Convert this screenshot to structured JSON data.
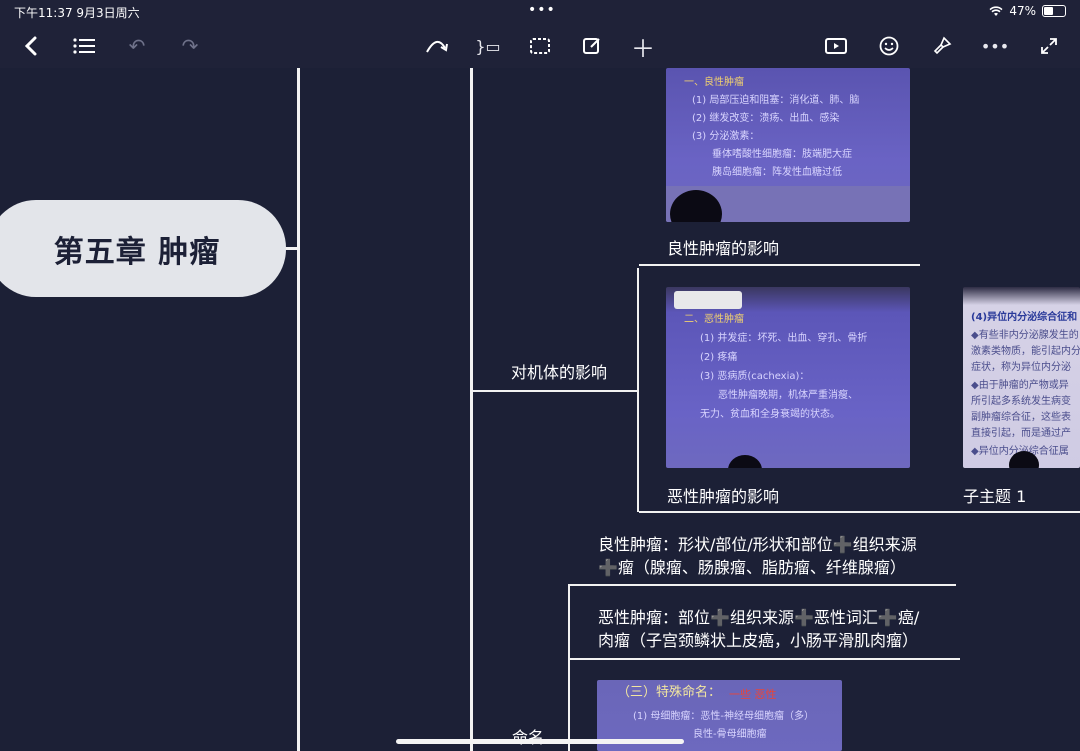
{
  "status": {
    "time": "下午11:37  9月3日周六",
    "dots": "•••",
    "battery": "47%"
  },
  "toolbar": {
    "back": "❮",
    "outline": "☰",
    "undo": "↶",
    "redo": "↷",
    "relationship": "⤼",
    "boundary": "}▭",
    "select": "⬚",
    "edit": "✎",
    "add": "＋",
    "present": "▶",
    "emoji": "☺",
    "brush": "🖌",
    "more": "•••",
    "expand": "⤢"
  },
  "mindmap": {
    "root": "第五章 肿瘤",
    "branch_effect": "对机体的影响",
    "benign_caption": "良性肿瘤的影响",
    "malignant_caption": "恶性肿瘤的影响",
    "subtopic_caption": "子主题 1",
    "naming_benign_line1": "良性肿瘤：形状/部位/形状和部位",
    "naming_benign_line1b": "组织来源",
    "naming_benign_line2": "瘤（腺瘤、肠腺瘤、脂肪瘤、纤维腺瘤）",
    "naming_malig_line1a": "恶性肿瘤：部位",
    "naming_malig_line1b": "组织来源",
    "naming_malig_line1c": "恶性词汇",
    "naming_malig_line1d": "癌/",
    "naming_malig_line2": "肉瘤（子宫颈鳞状上皮癌，小肠平滑肌肉瘤）",
    "plus": "➕",
    "branch_naming": "命名"
  },
  "slides": {
    "benign": [
      "一、良性肿瘤",
      "(1) 局部压迫和阻塞：消化道、肺、脑",
      "(2) 继发改变：溃疡、出血、感染",
      "(3) 分泌激素：",
      "垂体嗜酸性细胞瘤：肢端肥大症",
      "胰岛细胞瘤：阵发性血糖过低"
    ],
    "malignant": [
      "二、恶性肿瘤",
      "(1) 并发症：坏死、出血、穿孔、骨折",
      "(2) 疼痛",
      "(3) 恶病质(cachexia)：",
      "恶性肿瘤晚期，机体严重消瘦、",
      "无力、贫血和全身衰竭的状态。"
    ],
    "paraneoplastic": [
      "(4)异位内分泌综合征和",
      "◆有些非内分泌腺发生的",
      "激素类物质，能引起内分",
      "症状，称为异位内分泌",
      "◆由于肿瘤的产物或异",
      "所引起多系统发生病变",
      "副肿瘤综合征，这些表",
      "直接引起，而是通过产",
      "◆异位内分泌综合征属"
    ],
    "special": [
      "（三）特殊命名：",
      "(1) 母细胞瘤：恶性-神经母细胞瘤（多）",
      "良性-骨母细胞瘤"
    ],
    "special_note": "一些 恶性"
  }
}
